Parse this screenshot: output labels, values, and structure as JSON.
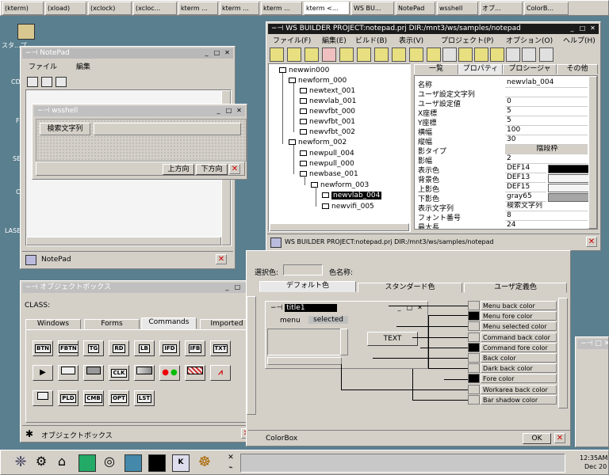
{
  "taskbar_top": {
    "buttons": [
      "(kterm)",
      "(xload)",
      "(xclock)",
      "(xcloc...",
      "kterm ...",
      "kterm ...",
      "kterm ...",
      "kterm <...",
      "WS BU...",
      "NotePad",
      "wsshell",
      "オブ...",
      "ColorB..."
    ]
  },
  "desktop": {
    "left_labels": [
      "スタ...プ",
      "CD",
      "F",
      "SE",
      "C",
      "F",
      "LASE"
    ]
  },
  "notepad": {
    "title": "NotePad",
    "menu": [
      "ファイル",
      "編集"
    ],
    "status_title": "NotePad"
  },
  "wsshell": {
    "title": "wsshell",
    "field_label": "検索文字列",
    "btn_up": "上方向",
    "btn_down": "下方向"
  },
  "wsbuilder": {
    "title": "WS BUILDER PROJECT:notepad.prj DIR:/mnt3/ws/samples/notepad",
    "menu": [
      "ファイル(F)",
      "編集(E)",
      "ビルド(B)",
      "表示(V)",
      "プロジェクト(P)",
      "オプション(O)",
      "ヘルプ(H)"
    ],
    "tree": [
      "newwin000",
      "newform_000",
      "newtext_001",
      "newvlab_001",
      "newvfbt_000",
      "newvfbt_001",
      "newvfbt_002",
      "newform_002",
      "newpull_004",
      "newpull_000",
      "newbase_001",
      "newform_003",
      "newvlab_004",
      "newvifi_005"
    ],
    "prop_tabs": [
      "一覧",
      "プロパティ",
      "プロシージャ",
      "その他"
    ],
    "props": [
      {
        "k": "名称",
        "v": "newvlab_004"
      },
      {
        "k": "ユーザ設定文字列",
        "v": ""
      },
      {
        "k": "ユーザ設定値",
        "v": "0"
      },
      {
        "k": "X座標",
        "v": "5"
      },
      {
        "k": "Y座標",
        "v": "5"
      },
      {
        "k": "横幅",
        "v": "100"
      },
      {
        "k": "縦幅",
        "v": "30"
      },
      {
        "k": "影タイプ",
        "v": "陰段枠"
      },
      {
        "k": "影幅",
        "v": "2"
      },
      {
        "k": "表示色",
        "v": "DEF14"
      },
      {
        "k": "背景色",
        "v": "DEF13"
      },
      {
        "k": "上影色",
        "v": "DEF15"
      },
      {
        "k": "下影色",
        "v": "gray65"
      },
      {
        "k": "表示文字列",
        "v": "検索文字列"
      },
      {
        "k": "フォント番号",
        "v": "8"
      },
      {
        "k": "最大長",
        "v": "24"
      }
    ],
    "status": "WS BUILDER PROJECT:notepad.prj DIR:/mnt3/ws/samples/notepad"
  },
  "objectbox": {
    "title": "オブジェクトボックス",
    "class_label": "CLASS:",
    "tabs": [
      "Windows",
      "Forms",
      "Commands",
      "Imported"
    ],
    "buttons": [
      "BTN",
      "FBTN",
      "TG",
      "RD",
      "LB",
      "IFD",
      "IFB",
      "TXT",
      "▶",
      "",
      "",
      "CLK",
      "",
      "",
      "",
      "",
      "",
      "PLD",
      "CMB",
      "OPT",
      "LST"
    ],
    "status_title": "オブジェクトボックス"
  },
  "colorbox": {
    "select_label": "選択色:",
    "name_label": "色名称:",
    "tabs": [
      "デフォルト色",
      "スタンダード色",
      "ユーザ定義色"
    ],
    "preview": {
      "title": "title1",
      "menu": "menu",
      "selected": "selected",
      "text": "TEXT"
    },
    "rows": [
      {
        "label": "Menu back color",
        "color": "#d4d0c8"
      },
      {
        "label": "Menu fore color",
        "color": "#000000"
      },
      {
        "label": "Menu selected color",
        "color": "#d4d0c8"
      },
      {
        "label": "Command back color",
        "color": "#d4d0c8"
      },
      {
        "label": "Command fore color",
        "color": "#000000"
      },
      {
        "label": "Back color",
        "color": "#d4d0c8"
      },
      {
        "label": "Dark back color",
        "color": "#d4d0c8"
      },
      {
        "label": "Fore color",
        "color": "#000000"
      },
      {
        "label": "Workarea back color",
        "color": "#d4d0c8"
      },
      {
        "label": "Bar shadow color",
        "color": "#d4d0c8"
      }
    ],
    "ok": "OK",
    "status_title": "ColorBox"
  },
  "clock": {
    "time": "12:35AM",
    "date": "Dec 20"
  }
}
